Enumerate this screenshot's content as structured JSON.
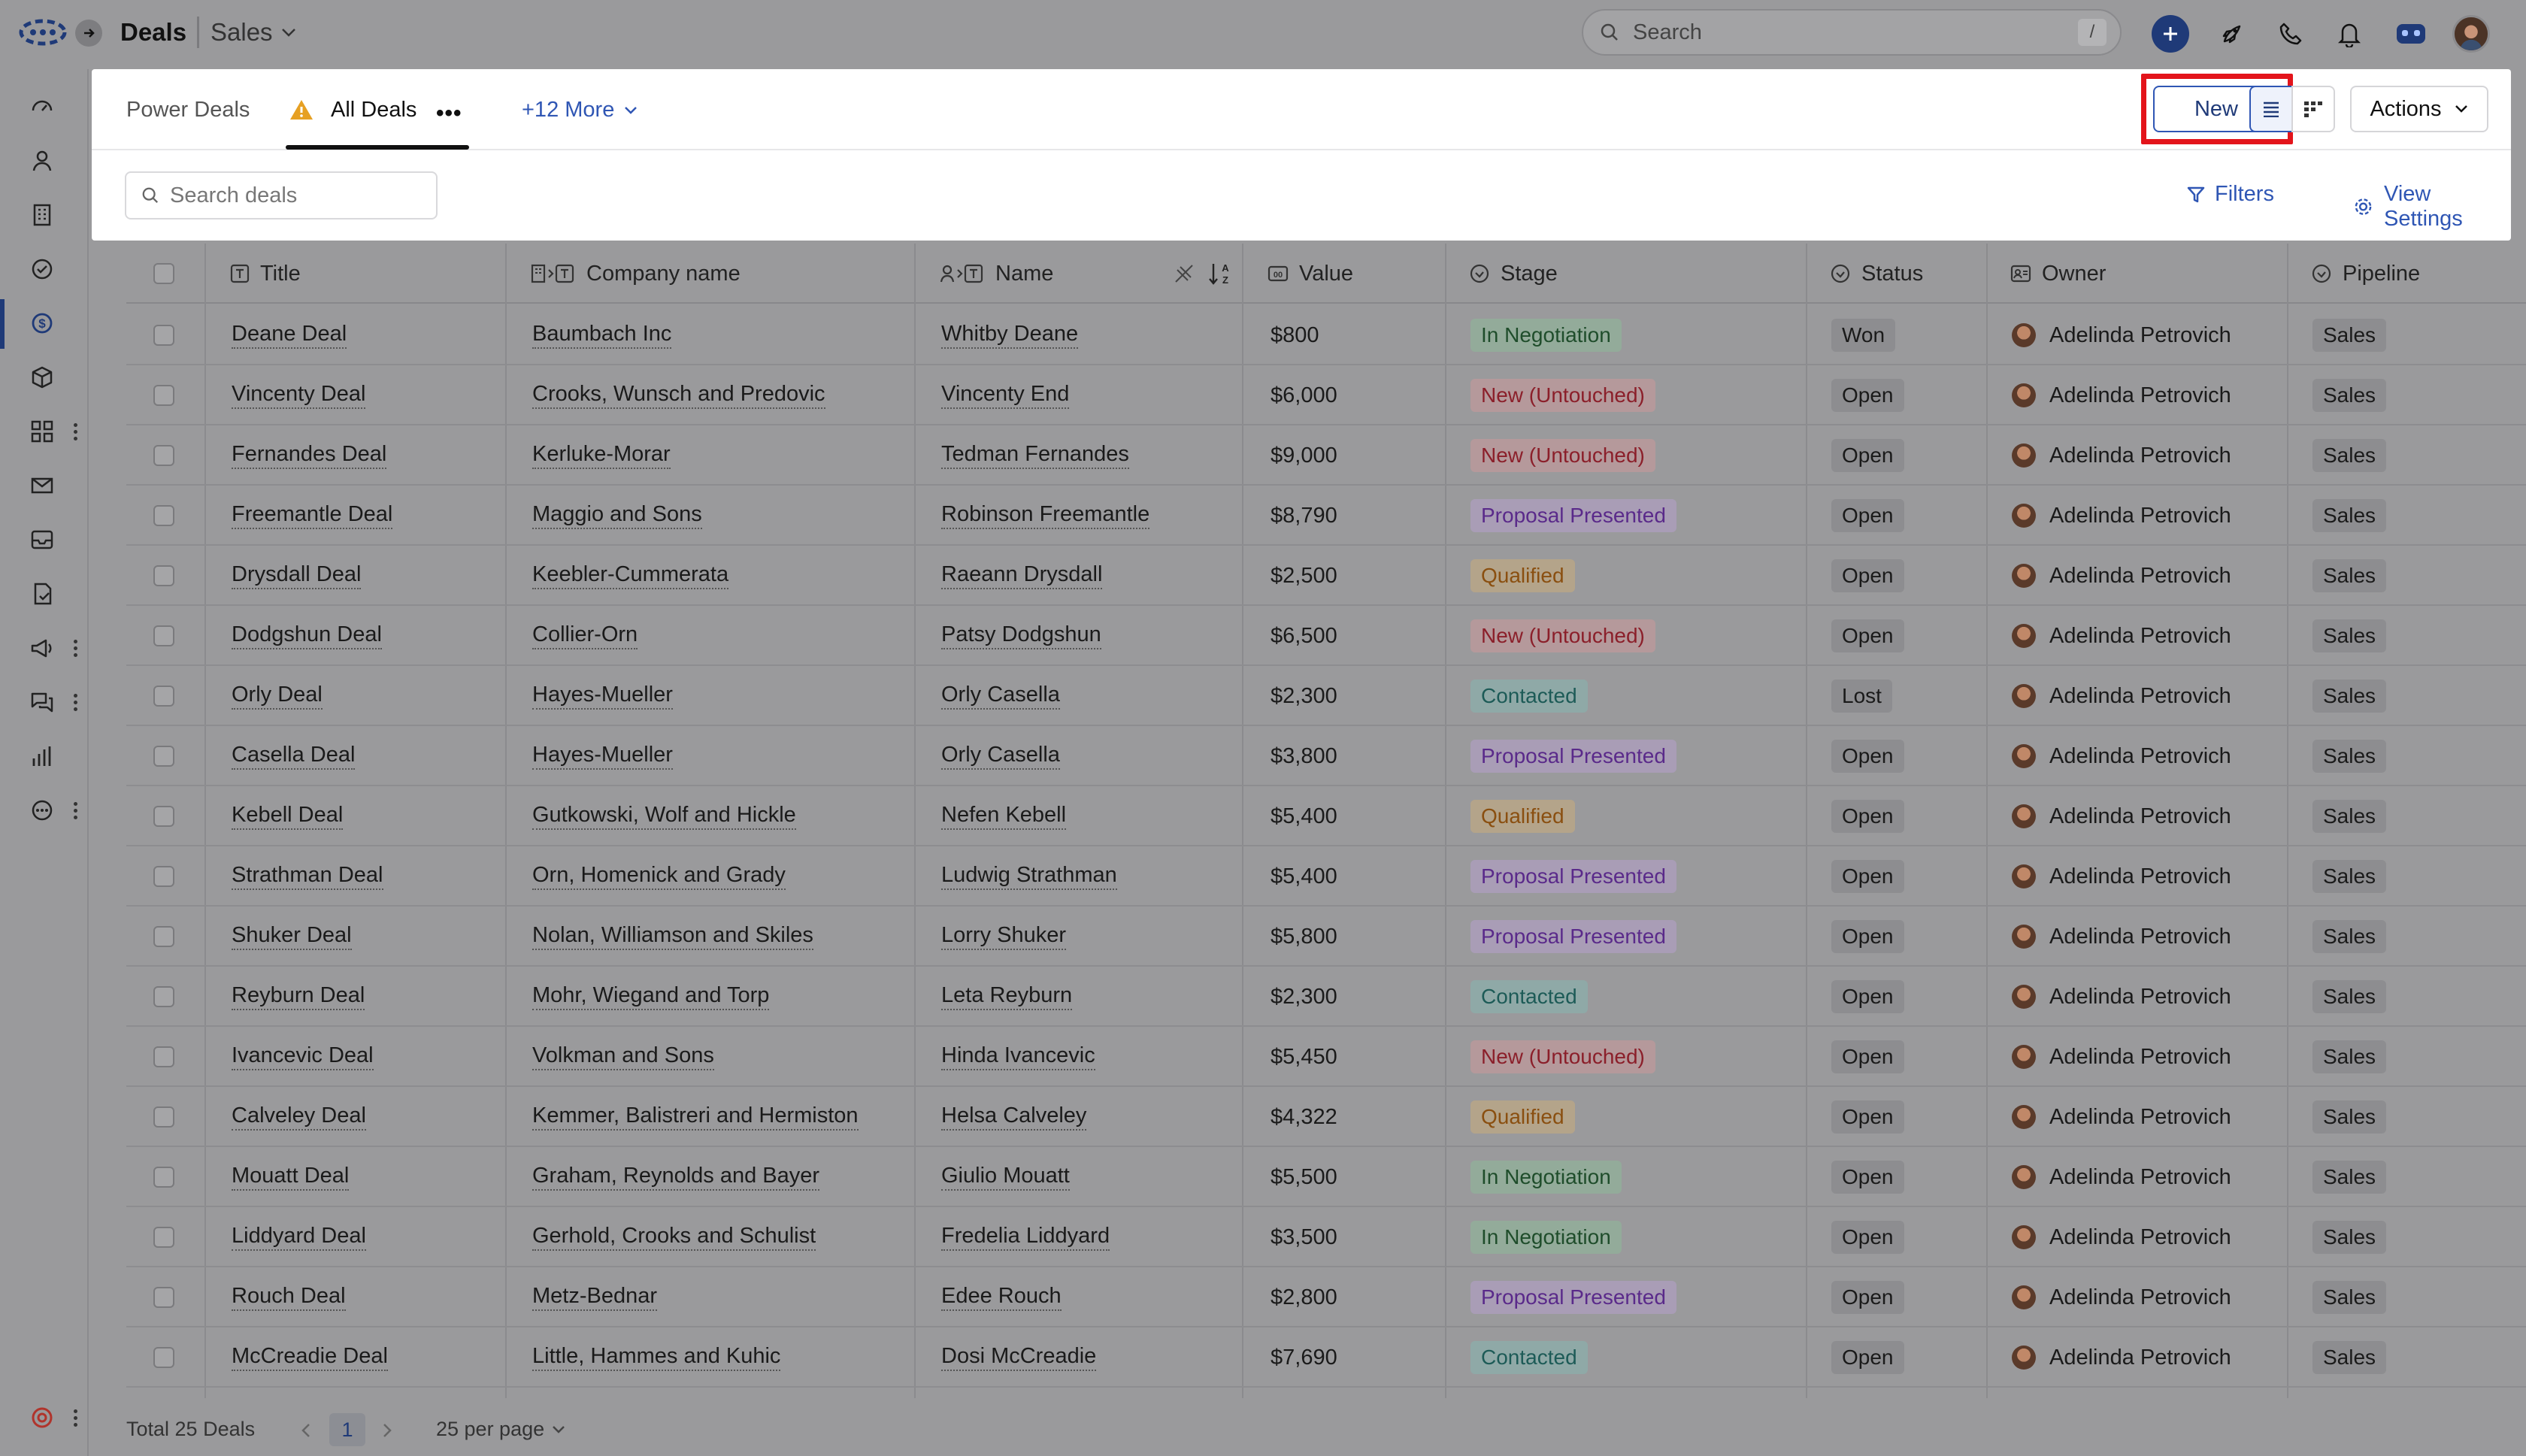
{
  "app": {
    "breadcrumb_title": "Deals",
    "breadcrumb_sub": "Sales",
    "search_placeholder": "Search",
    "search_shortcut": "/"
  },
  "tabs": {
    "power_deals": "Power Deals",
    "all_deals": "All Deals",
    "more": "+12 More"
  },
  "toolbar": {
    "new_label": "New",
    "actions_label": "Actions",
    "deal_search_placeholder": "Search deals",
    "filters_label": "Filters",
    "view_settings_label": "View Settings"
  },
  "columns": [
    "Title",
    "Company name",
    "Name",
    "Value",
    "Stage",
    "Status",
    "Owner",
    "Pipeline"
  ],
  "rows": [
    {
      "title": "Deane Deal",
      "company": "Baumbach Inc",
      "name": "Whitby Deane",
      "value": "$800",
      "stage": "In Negotiation",
      "status": "Won",
      "owner": "Adelinda Petrovich",
      "pipeline": "Sales"
    },
    {
      "title": "Vincenty Deal",
      "company": "Crooks, Wunsch and Predovic",
      "name": "Vincenty End",
      "value": "$6,000",
      "stage": "New (Untouched)",
      "status": "Open",
      "owner": "Adelinda Petrovich",
      "pipeline": "Sales"
    },
    {
      "title": "Fernandes Deal",
      "company": "Kerluke-Morar",
      "name": "Tedman Fernandes",
      "value": "$9,000",
      "stage": "New (Untouched)",
      "status": "Open",
      "owner": "Adelinda Petrovich",
      "pipeline": "Sales"
    },
    {
      "title": "Freemantle Deal",
      "company": "Maggio and Sons",
      "name": "Robinson Freemantle",
      "value": "$8,790",
      "stage": "Proposal Presented",
      "status": "Open",
      "owner": "Adelinda Petrovich",
      "pipeline": "Sales"
    },
    {
      "title": "Drysdall Deal",
      "company": "Keebler-Cummerata",
      "name": "Raeann Drysdall",
      "value": "$2,500",
      "stage": "Qualified",
      "status": "Open",
      "owner": "Adelinda Petrovich",
      "pipeline": "Sales"
    },
    {
      "title": "Dodgshun Deal",
      "company": "Collier-Orn",
      "name": "Patsy Dodgshun",
      "value": "$6,500",
      "stage": "New (Untouched)",
      "status": "Open",
      "owner": "Adelinda Petrovich",
      "pipeline": "Sales"
    },
    {
      "title": "Orly Deal",
      "company": "Hayes-Mueller",
      "name": "Orly Casella",
      "value": "$2,300",
      "stage": "Contacted",
      "status": "Lost",
      "owner": "Adelinda Petrovich",
      "pipeline": "Sales"
    },
    {
      "title": "Casella Deal",
      "company": "Hayes-Mueller",
      "name": "Orly Casella",
      "value": "$3,800",
      "stage": "Proposal Presented",
      "status": "Open",
      "owner": "Adelinda Petrovich",
      "pipeline": "Sales"
    },
    {
      "title": "Kebell Deal",
      "company": "Gutkowski, Wolf and Hickle",
      "name": "Nefen Kebell",
      "value": "$5,400",
      "stage": "Qualified",
      "status": "Open",
      "owner": "Adelinda Petrovich",
      "pipeline": "Sales"
    },
    {
      "title": "Strathman Deal",
      "company": "Orn, Homenick and Grady",
      "name": "Ludwig Strathman",
      "value": "$5,400",
      "stage": "Proposal Presented",
      "status": "Open",
      "owner": "Adelinda Petrovich",
      "pipeline": "Sales"
    },
    {
      "title": "Shuker Deal",
      "company": "Nolan, Williamson and Skiles",
      "name": "Lorry Shuker",
      "value": "$5,800",
      "stage": "Proposal Presented",
      "status": "Open",
      "owner": "Adelinda Petrovich",
      "pipeline": "Sales"
    },
    {
      "title": "Reyburn Deal",
      "company": "Mohr, Wiegand and Torp",
      "name": "Leta Reyburn",
      "value": "$2,300",
      "stage": "Contacted",
      "status": "Open",
      "owner": "Adelinda Petrovich",
      "pipeline": "Sales"
    },
    {
      "title": "Ivancevic Deal",
      "company": "Volkman and Sons",
      "name": "Hinda Ivancevic",
      "value": "$5,450",
      "stage": "New (Untouched)",
      "status": "Open",
      "owner": "Adelinda Petrovich",
      "pipeline": "Sales"
    },
    {
      "title": "Calveley Deal",
      "company": "Kemmer, Balistreri and Hermiston",
      "name": "Helsa Calveley",
      "value": "$4,322",
      "stage": "Qualified",
      "status": "Open",
      "owner": "Adelinda Petrovich",
      "pipeline": "Sales"
    },
    {
      "title": "Mouatt Deal",
      "company": "Graham, Reynolds and Bayer",
      "name": "Giulio Mouatt",
      "value": "$5,500",
      "stage": "In Negotiation",
      "status": "Open",
      "owner": "Adelinda Petrovich",
      "pipeline": "Sales"
    },
    {
      "title": "Liddyard Deal",
      "company": "Gerhold, Crooks and Schulist",
      "name": "Fredelia Liddyard",
      "value": "$3,500",
      "stage": "In Negotiation",
      "status": "Open",
      "owner": "Adelinda Petrovich",
      "pipeline": "Sales"
    },
    {
      "title": "Rouch Deal",
      "company": "Metz-Bednar",
      "name": "Edee Rouch",
      "value": "$2,800",
      "stage": "Proposal Presented",
      "status": "Open",
      "owner": "Adelinda Petrovich",
      "pipeline": "Sales"
    },
    {
      "title": "McCreadie Deal",
      "company": "Little, Hammes and Kuhic",
      "name": "Dosi McCreadie",
      "value": "$7,690",
      "stage": "Contacted",
      "status": "Open",
      "owner": "Adelinda Petrovich",
      "pipeline": "Sales"
    }
  ],
  "stage_colors": {
    "In Negotiation": "green",
    "New (Untouched)": "red",
    "Proposal Presented": "purple",
    "Qualified": "amber",
    "Contacted": "teal"
  },
  "footer": {
    "total_label": "Total 25 Deals",
    "current_page": "1",
    "per_page_label": "25 per page"
  },
  "icons": {
    "sidebar": [
      "dashboard-icon",
      "contacts-icon",
      "companies-icon",
      "tasks-icon",
      "deals-icon",
      "products-icon",
      "apps-icon",
      "mail-icon",
      "inbox-icon",
      "documents-icon",
      "campaigns-icon",
      "chat-icon",
      "reports-icon",
      "more-icon",
      "help-icon"
    ]
  },
  "colors": {
    "accent": "#2f56b4",
    "brand_dark": "#1f3a78",
    "highlight": "#e3141b"
  }
}
